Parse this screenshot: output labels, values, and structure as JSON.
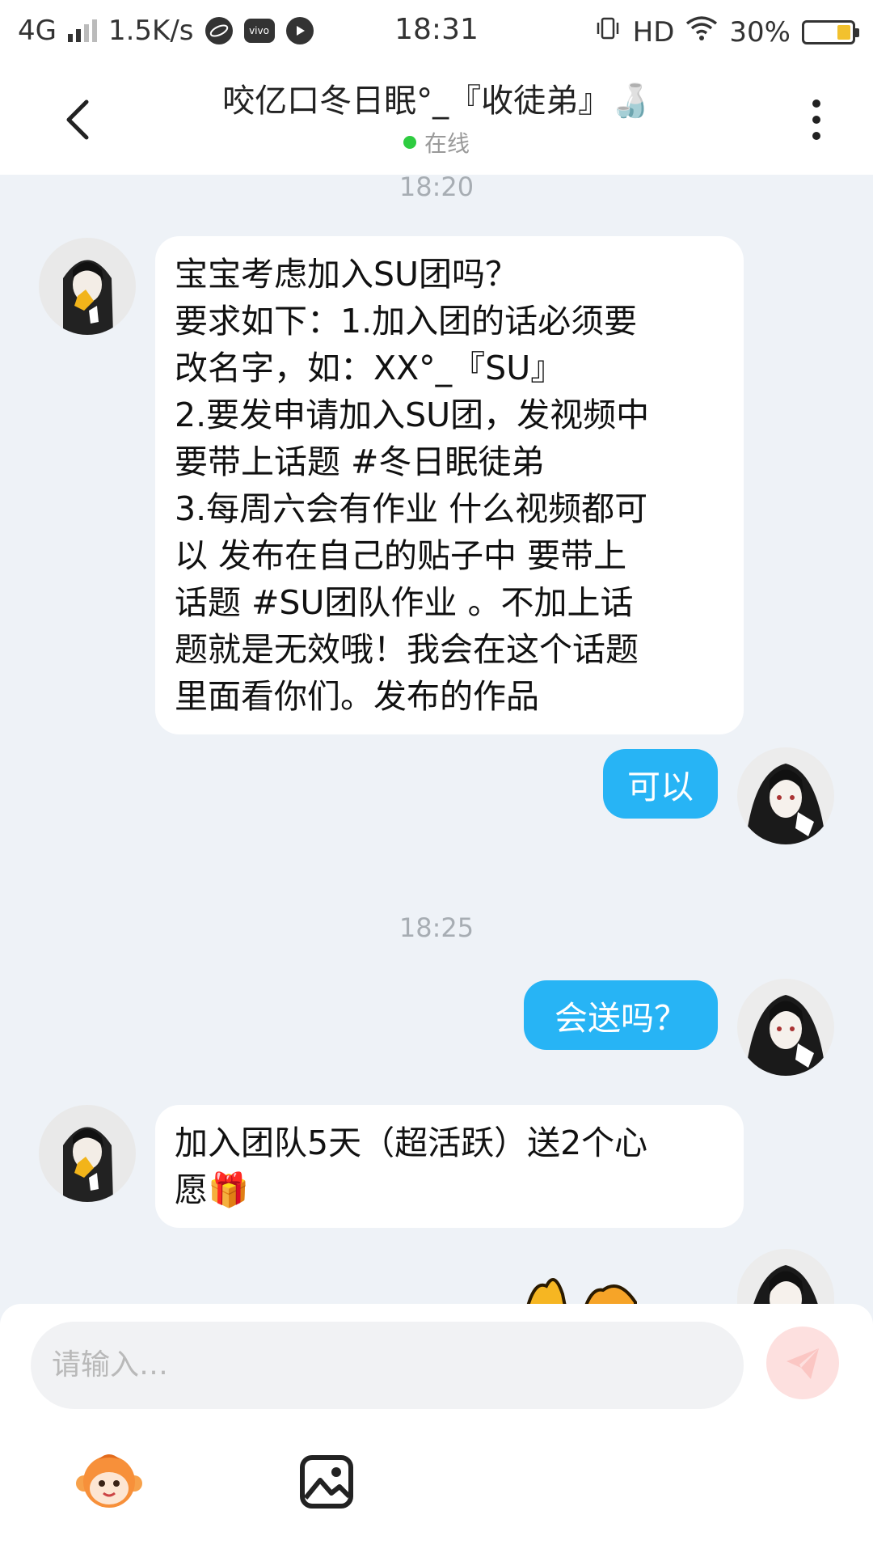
{
  "status_bar": {
    "network": "4G",
    "speed": "1.5K/s",
    "time": "18:31",
    "hd": "HD",
    "battery": "30%",
    "battery_level": 0.3
  },
  "header": {
    "title": "咬亿口冬日眠°_『收徒弟』🍶",
    "status": "在线"
  },
  "messages": [
    {
      "type": "timestamp",
      "text": "18:20"
    },
    {
      "type": "incoming",
      "lines": [
        "宝宝考虑加入SU团吗？",
        "要求如下：1.加入团的话必须要",
        "改名字，如：XX°_『SU』",
        "2.要发申请加入SU团，发视频中",
        "要带上话题 #冬日眠徒弟",
        "3.每周六会有作业 什么视频都可",
        "以 发布在自己的贴子中 要带上",
        "话题 #SU团队作业 。不加上话",
        "题就是无效哦！我会在这个话题",
        "里面看你们。发布的作品"
      ]
    },
    {
      "type": "outgoing",
      "text": "可以"
    },
    {
      "type": "timestamp",
      "text": "18:25"
    },
    {
      "type": "outgoing",
      "text": "会送吗？"
    },
    {
      "type": "incoming",
      "lines": [
        "加入团队5天（超活跃）送2个心",
        "愿🎁"
      ]
    }
  ],
  "composer": {
    "placeholder": "请输入…"
  },
  "colors": {
    "outgoing_bubble": "#27b4f5",
    "send_button": "#fde0df",
    "online_dot": "#2ecc40",
    "background": "#eef2f7"
  }
}
